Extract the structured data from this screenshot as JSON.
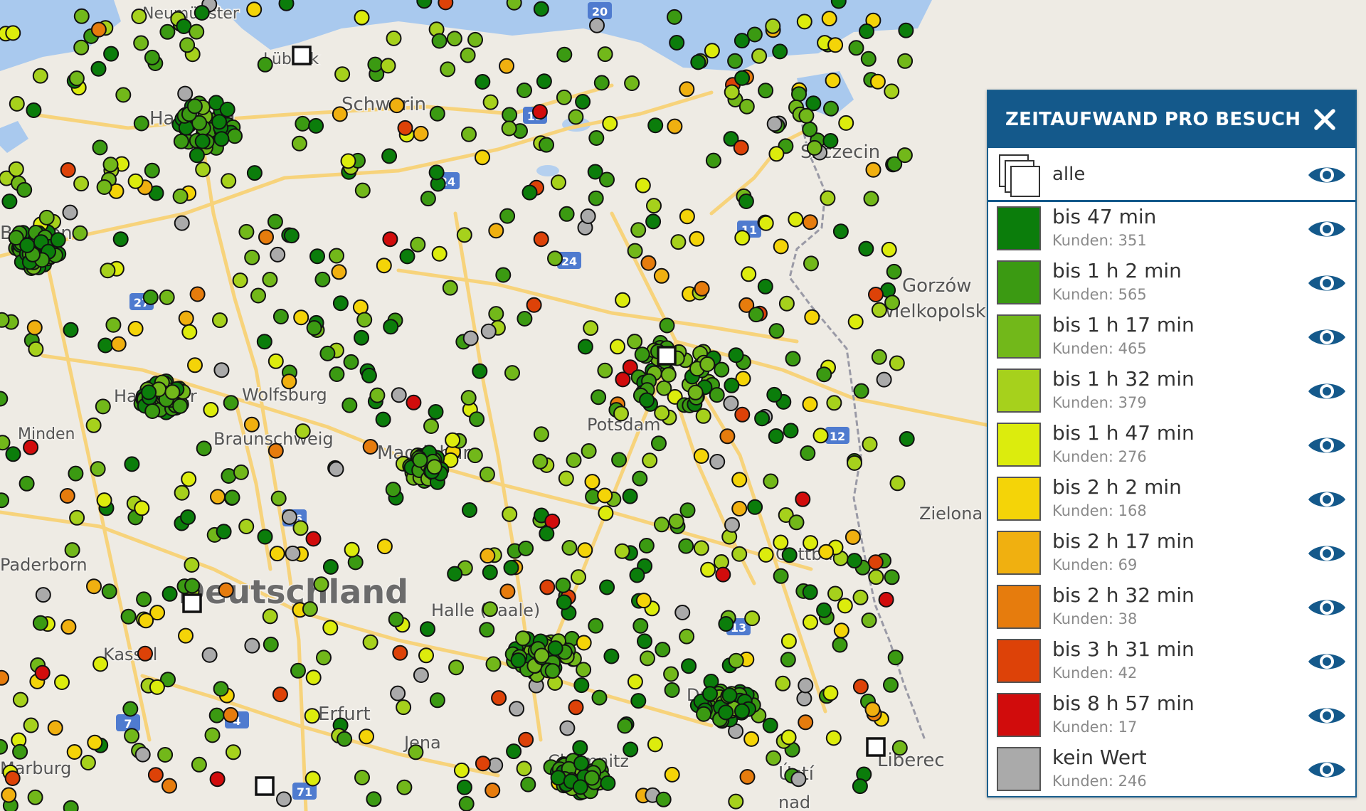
{
  "colors": {
    "water": "#a9c9ee",
    "land": "#eeebe4",
    "road": "#f7d37b",
    "border": "#9a9aa6",
    "header": "#14598b",
    "eye": "#14598b"
  },
  "map": {
    "city_labels": [
      {
        "name": "Neumünster"
      },
      {
        "name": "Lübeck"
      },
      {
        "name": "Schwerin"
      },
      {
        "name": "Hamburg"
      },
      {
        "name": "Bremen"
      },
      {
        "name": "Szczecin"
      },
      {
        "name": "Gorzów"
      },
      {
        "name": "Wielkopolski"
      },
      {
        "name": "Hannover"
      },
      {
        "name": "Wolfsburg"
      },
      {
        "name": "Braunschweig"
      },
      {
        "name": "Minden"
      },
      {
        "name": "Magdeburg"
      },
      {
        "name": "Potsdam"
      },
      {
        "name": "Zielona"
      },
      {
        "name": "Cottbus"
      },
      {
        "name": "Paderborn"
      },
      {
        "name": "Deutschland"
      },
      {
        "name": "Halle (Saale)"
      },
      {
        "name": "Kassel"
      },
      {
        "name": "Erfurt"
      },
      {
        "name": "Jena"
      },
      {
        "name": "Dresden"
      },
      {
        "name": "Ústí"
      },
      {
        "name": "nad"
      },
      {
        "name": "Liberec"
      },
      {
        "name": "Marburg"
      },
      {
        "name": "Chemnitz"
      }
    ],
    "road_shields": [
      "20",
      "19",
      "24",
      "24",
      "11",
      "27",
      "12",
      "36",
      "13",
      "4",
      "71",
      "7"
    ]
  },
  "legend": {
    "title": "ZEITAUFWAND PRO BESUCH",
    "close_icon": "close-icon",
    "all_label": "alle",
    "eye_icon": "eye-icon",
    "items": [
      {
        "label": "bis 47 min",
        "count": "Kunden: 351",
        "color": "#0b7d0b"
      },
      {
        "label": "bis 1 h 2 min",
        "count": "Kunden: 565",
        "color": "#3b9a12"
      },
      {
        "label": "bis 1 h 17 min",
        "count": "Kunden: 465",
        "color": "#72b81a"
      },
      {
        "label": "bis 1 h 32 min",
        "count": "Kunden: 379",
        "color": "#a6d11c"
      },
      {
        "label": "bis 1 h 47 min",
        "count": "Kunden: 276",
        "color": "#dcec0d"
      },
      {
        "label": "bis 2 h 2 min",
        "count": "Kunden: 168",
        "color": "#f4d408"
      },
      {
        "label": "bis 2 h 17 min",
        "count": "Kunden: 69",
        "color": "#f0b010"
      },
      {
        "label": "bis 2 h 32 min",
        "count": "Kunden: 38",
        "color": "#e67c0d"
      },
      {
        "label": "bis 3 h 31 min",
        "count": "Kunden: 42",
        "color": "#dd4208"
      },
      {
        "label": "bis 8 h 57 min",
        "count": "Kunden: 17",
        "color": "#d10c0c"
      },
      {
        "label": "kein Wert",
        "count": "Kunden: 246",
        "color": "#aaaaaa"
      }
    ]
  }
}
